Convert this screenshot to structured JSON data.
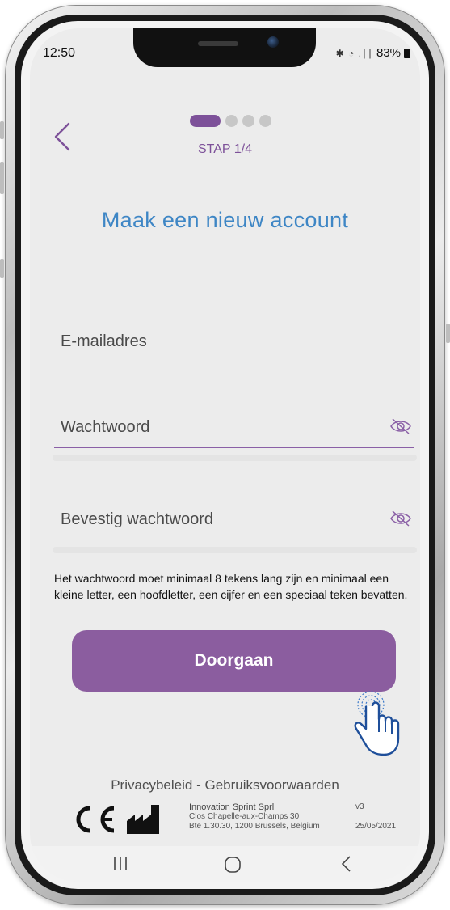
{
  "status_bar": {
    "time": "12:50",
    "signal_icons": "✱ ◔ .∣∣",
    "battery": "83%"
  },
  "header": {
    "step_label": "STAP 1/4",
    "steps_total": 4,
    "steps_current": 1
  },
  "page": {
    "title": "Maak een nieuw account"
  },
  "form": {
    "email_placeholder": "E-mailadres",
    "password_placeholder": "Wachtwoord",
    "confirm_placeholder": "Bevestig wachtwoord",
    "hint": "Het wachtwoord moet minimaal 8 tekens lang zijn en minimaal een kleine letter, een hoofdletter, een cijfer en een speciaal teken bevatten.",
    "submit_label": "Doorgaan"
  },
  "footer": {
    "privacy": "Privacybeleid",
    "separator": "-",
    "terms": "Gebruiksvoorwaarden",
    "company_name": "Innovation Sprint Sprl",
    "address_line1": "Clos Chapelle-aux-Champs 30",
    "address_line2": "Bte 1.30.30, 1200 Brussels, Belgium",
    "version": "v3",
    "date": "25/05/2021"
  },
  "colors": {
    "accent": "#8b5d9f",
    "title": "#3e86c5",
    "background": "#ececec"
  },
  "icons": [
    "chevron-left-icon",
    "eye-off-icon",
    "ce-mark-icon",
    "manufacturer-icon",
    "tap-hand-icon",
    "recent-apps-icon",
    "home-icon",
    "back-icon"
  ]
}
